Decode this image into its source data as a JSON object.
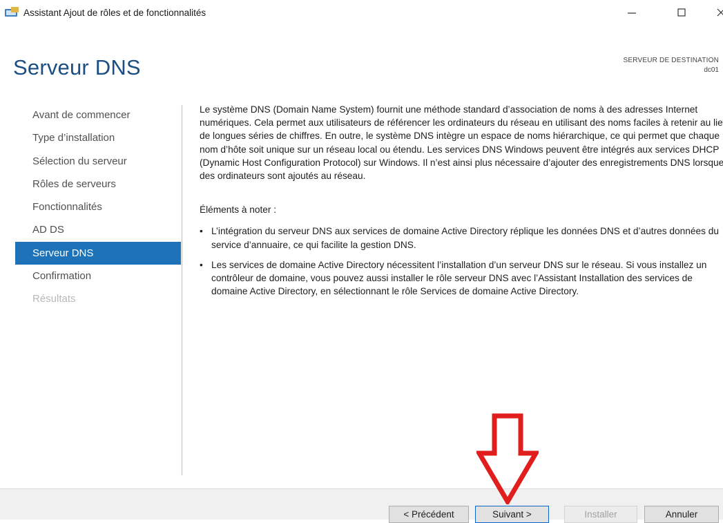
{
  "window": {
    "title": "Assistant Ajout de rôles et de fonctionnalités"
  },
  "header": {
    "page_title": "Serveur DNS",
    "destination_label": "SERVEUR DE DESTINATION",
    "destination_server": "dc01"
  },
  "sidebar": {
    "items": [
      {
        "label": "Avant de commencer",
        "state": "normal"
      },
      {
        "label": "Type d’installation",
        "state": "normal"
      },
      {
        "label": "Sélection du serveur",
        "state": "normal"
      },
      {
        "label": "Rôles de serveurs",
        "state": "normal"
      },
      {
        "label": "Fonctionnalités",
        "state": "normal"
      },
      {
        "label": "AD DS",
        "state": "normal"
      },
      {
        "label": "Serveur DNS",
        "state": "active"
      },
      {
        "label": "Confirmation",
        "state": "normal"
      },
      {
        "label": "Résultats",
        "state": "disabled"
      }
    ]
  },
  "main": {
    "description": "Le système DNS (Domain Name System) fournit une méthode standard d’association de noms à des adresses Internet numériques. Cela permet aux utilisateurs de référencer les ordinateurs du réseau en utilisant des noms faciles à retenir au lieu de longues séries de chiffres. En outre, le système DNS intègre un espace de noms hiérarchique, ce qui permet que chaque nom d’hôte soit unique sur un réseau local ou étendu. Les services DNS Windows peuvent être intégrés aux services DHCP (Dynamic Host Configuration Protocol) sur Windows. Il n’est ainsi plus nécessaire d’ajouter des enregistrements DNS lorsque des ordinateurs sont ajoutés au réseau.",
    "notes_title": "Éléments à noter :",
    "notes": [
      "L’intégration du serveur DNS aux services de domaine Active Directory réplique les données DNS et d’autres données du service d’annuaire, ce qui facilite la gestion DNS.",
      "Les services de domaine Active Directory nécessitent l’installation d’un serveur DNS sur le réseau. Si vous installez un contrôleur de domaine, vous pouvez aussi installer le rôle serveur DNS avec l’Assistant Installation des services de domaine Active Directory, en sélectionnant le rôle Services de domaine Active Directory."
    ],
    "bullet": "•"
  },
  "footer": {
    "previous_label": "< Précédent",
    "next_label": "Suivant >",
    "install_label": "Installer",
    "cancel_label": "Annuler"
  },
  "colors": {
    "title_blue": "#1b4f84",
    "nav_active_bg": "#1e73b8",
    "annotation_arrow": "#e01e1e"
  },
  "icons": {
    "app": "server-manager-icon",
    "annotation": "down-arrow-annotation-icon"
  }
}
